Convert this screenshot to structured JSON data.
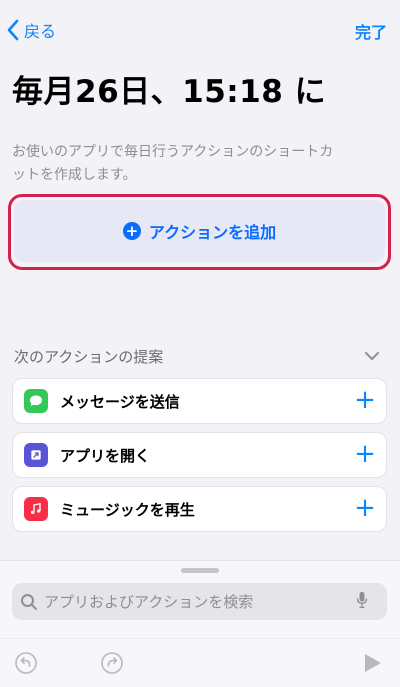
{
  "nav": {
    "back_label": "戻る",
    "done_label": "完了"
  },
  "title": "毎月26日、15:18 に",
  "description": "お使いのアプリで毎日行うアクションのショートカットを作成します。",
  "add_action": {
    "label": "アクションを追加",
    "plus": "+"
  },
  "suggestions": {
    "header": "次のアクションの提案",
    "items": [
      {
        "label": "メッセージを送信",
        "icon": "messages-icon",
        "color": "#34c759"
      },
      {
        "label": "アプリを開く",
        "icon": "open-app-icon",
        "color": "#5856d6"
      },
      {
        "label": "ミュージックを再生",
        "icon": "music-icon",
        "color": "#fa2d48"
      }
    ],
    "plus": "+"
  },
  "search": {
    "placeholder": "アプリおよびアクションを検索"
  },
  "colors": {
    "accent": "#0a84ff",
    "highlight_outline": "#d6204f"
  }
}
